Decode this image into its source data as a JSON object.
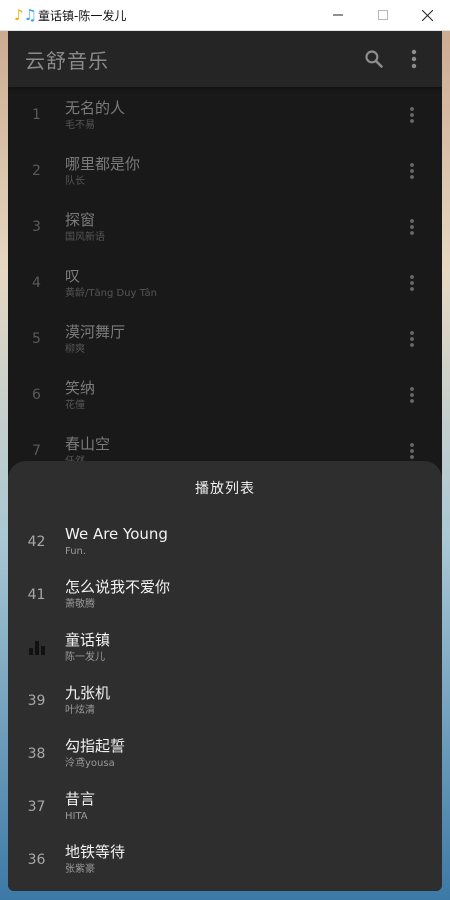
{
  "window": {
    "title": "童话镇-陈一发儿",
    "controls": [
      "minimize",
      "maximize",
      "close"
    ]
  },
  "appbar": {
    "title": "云舒音乐",
    "icons": [
      "search-icon",
      "more-vert-icon"
    ]
  },
  "songs": [
    {
      "index": "1",
      "title": "无名的人",
      "artist": "毛不易"
    },
    {
      "index": "2",
      "title": "哪里都是你",
      "artist": "队长"
    },
    {
      "index": "3",
      "title": "探窗",
      "artist": "国风新语"
    },
    {
      "index": "4",
      "title": "叹",
      "artist": "黄龄/Tăng Duy Tân"
    },
    {
      "index": "5",
      "title": "漠河舞厅",
      "artist": "柳爽"
    },
    {
      "index": "6",
      "title": "笑纳",
      "artist": "花僮"
    },
    {
      "index": "7",
      "title": "春山空",
      "artist": "任然"
    }
  ],
  "playlist": {
    "title": "播放列表",
    "items": [
      {
        "index": "42",
        "title": "We Are Young",
        "artist": "Fun."
      },
      {
        "index": "41",
        "title": "怎么说我不爱你",
        "artist": "萧敬腾"
      },
      {
        "index": "",
        "title": "童话镇",
        "artist": "陈一发儿",
        "playing": true
      },
      {
        "index": "39",
        "title": "九张机",
        "artist": "叶炫清"
      },
      {
        "index": "38",
        "title": "勾指起誓",
        "artist": "泠鸢yousa"
      },
      {
        "index": "37",
        "title": "昔言",
        "artist": "HITA"
      },
      {
        "index": "36",
        "title": "地铁等待",
        "artist": "张紫豪"
      }
    ]
  },
  "colors": {
    "background": "#191919",
    "appbar": "#252525",
    "sheet": "#2e2e2e"
  }
}
